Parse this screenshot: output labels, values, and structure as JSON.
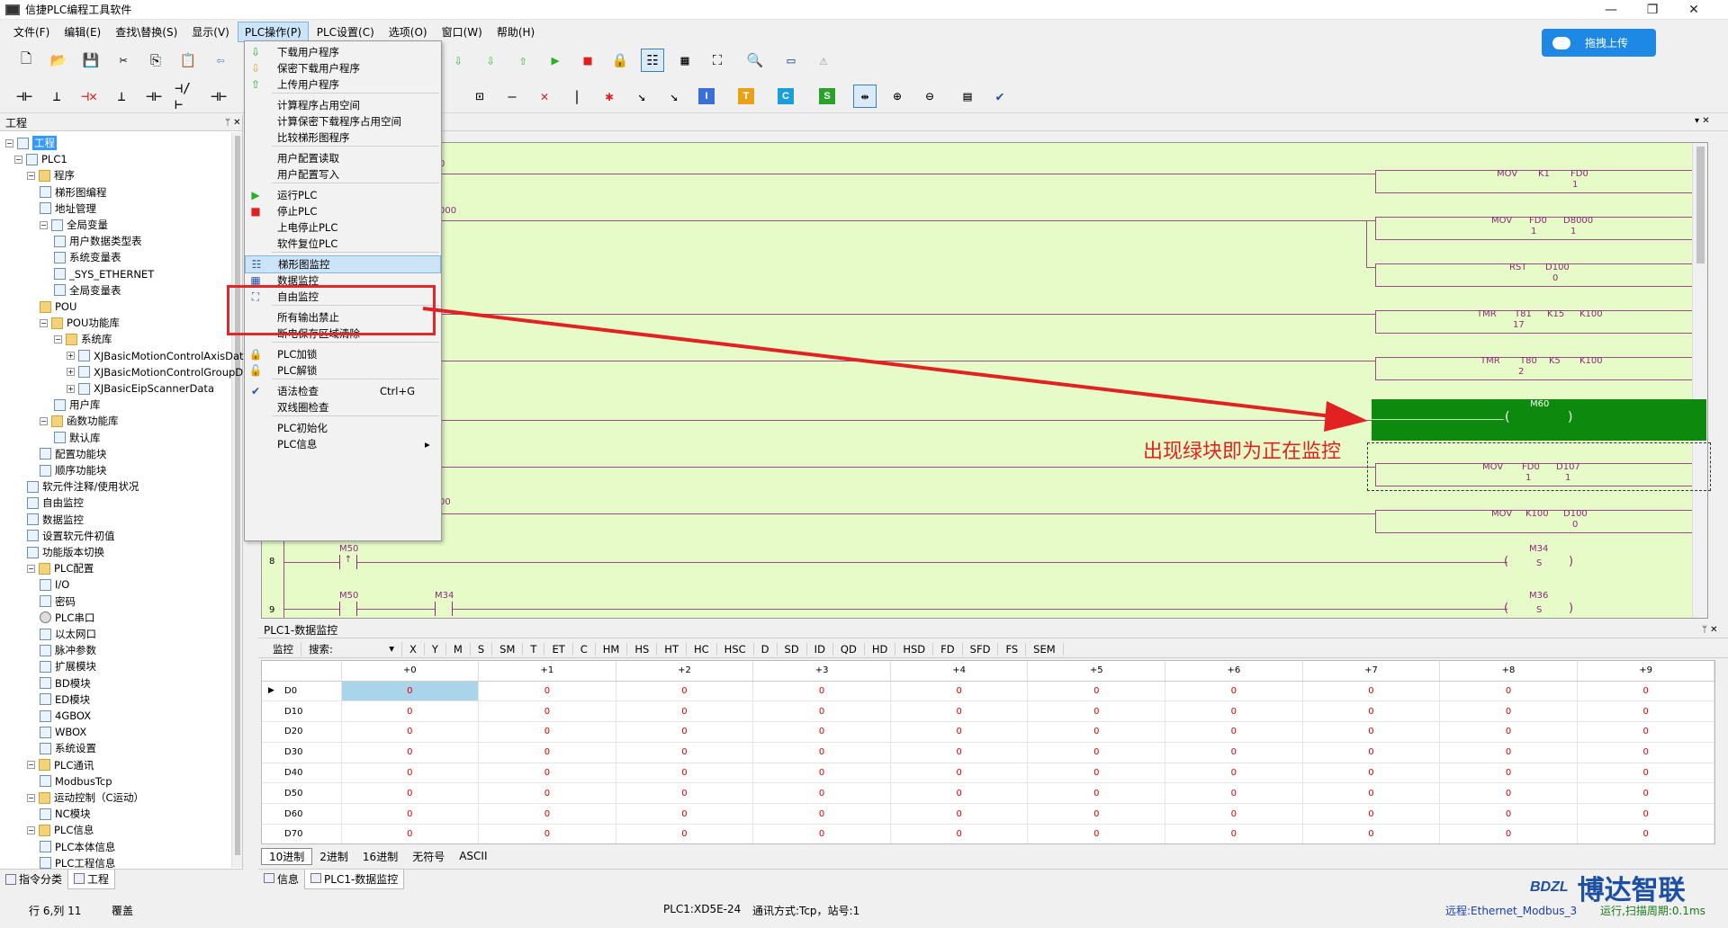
{
  "window": {
    "title": "信捷PLC编程工具软件",
    "min": "—",
    "max": "❐",
    "close": "✕"
  },
  "menubar": [
    "文件(F)",
    "编辑(E)",
    "查找\\替换(S)",
    "显示(V)",
    "PLC操作(P)",
    "PLC设置(C)",
    "选项(O)",
    "窗口(W)",
    "帮助(H)"
  ],
  "upload_button": "拖拽上传",
  "project_panel": {
    "title": "工程",
    "pin": "ᛘ  ✕",
    "tree": [
      "工程",
      "PLC1",
      "程序",
      "梯形图编程",
      "地址管理",
      "全局变量",
      "用户数据类型表",
      "系统变量表",
      "_SYS_ETHERNET",
      "全局变量表",
      "POU",
      "POU功能库",
      "系统库",
      "XJBasicMotionControlAxisDat",
      "XJBasicMotionControlGroupD",
      "XJBasicEipScannerData",
      "用户库",
      "函数功能库",
      "默认库",
      "配置功能块",
      "顺序功能块",
      "软元件注释/使用状况",
      "自由监控",
      "数据监控",
      "设置软元件初值",
      "功能版本切换",
      "PLC配置",
      "I/O",
      "密码",
      "PLC串口",
      "以太网口",
      "脉冲参数",
      "扩展模块",
      "BD模块",
      "ED模块",
      "4GBOX",
      "WBOX",
      "系统设置",
      "PLC通讯",
      "ModbusTcp",
      "运动控制（C运动）",
      "NC模块",
      "PLC信息",
      "PLC本体信息",
      "PLC工程信息"
    ],
    "bottom_tabs": [
      "指令分类",
      "工程"
    ]
  },
  "plc_menu": {
    "items": [
      "下载用户程序",
      "保密下载用户程序",
      "上传用户程序",
      "计算程序占用空间",
      "计算保密下载程序占用空间",
      "比较梯形图程序",
      "用户配置读取",
      "用户配置写入",
      "运行PLC",
      "停止PLC",
      "上电停止PLC",
      "软件复位PLC",
      "梯形图监控",
      "数据监控",
      "自由监控",
      "所有输出禁止",
      "断电保存区域清除",
      "PLC加锁",
      "PLC解锁",
      "语法检查",
      "双线圈检查",
      "PLC初始化",
      "PLC信息"
    ],
    "shortcut_syntax": "Ctrl+G",
    "submenu_arrow": "▸"
  },
  "ladder": {
    "blocks": [
      {
        "op": "MOV",
        "a": "K1",
        "b": "FD0",
        "va": "",
        "vb": "1"
      },
      {
        "op": "MOV",
        "a": "FD0",
        "b": "D8000",
        "va": "1",
        "vb": "1"
      },
      {
        "op": "RST",
        "a": "D100",
        "b": "",
        "va": "0",
        "vb": ""
      },
      {
        "op": "TMR",
        "a": "T81",
        "b": "K15",
        "c": "K100",
        "va": "17"
      },
      {
        "op": "TMR",
        "a": "T80",
        "b": "K5",
        "c": "K100",
        "va": "2"
      },
      {
        "op": "MOV",
        "a": "FD0",
        "b": "D107",
        "va": "1",
        "vb": "1"
      },
      {
        "op": "MOV",
        "a": "K100",
        "b": "D100",
        "va": "",
        "vb": "0"
      }
    ],
    "partial_labels": [
      "0",
      "000",
      "00"
    ],
    "coil_green": "M60",
    "coil_paren_l": "(",
    "coil_paren_r": ")",
    "annotation": "出现绿块即为正在监控",
    "row8": {
      "num": "8",
      "contact": "M50",
      "coil": "M34",
      "coil_op": "S"
    },
    "row9": {
      "num": "9",
      "contact1": "M50",
      "contact2": "M34",
      "coil": "M36",
      "coil_op": "S"
    }
  },
  "data_monitor": {
    "title": "PLC1-数据监控",
    "pin": "ᛘ  ✕",
    "bar_monitor": "监控",
    "bar_search": "搜索:",
    "bar_dropdown": "▾",
    "types": [
      "X",
      "Y",
      "M",
      "S",
      "SM",
      "T",
      "ET",
      "C",
      "HM",
      "HS",
      "HT",
      "HC",
      "HSC",
      "D",
      "SD",
      "ID",
      "QD",
      "HD",
      "HSD",
      "FD",
      "SFD",
      "FS",
      "SEM"
    ],
    "columns": [
      "+0",
      "+1",
      "+2",
      "+3",
      "+4",
      "+5",
      "+6",
      "+7",
      "+8",
      "+9"
    ],
    "rows": [
      {
        "addr": "D0",
        "vals": [
          "0",
          "0",
          "0",
          "0",
          "0",
          "0",
          "0",
          "0",
          "0",
          "0"
        ]
      },
      {
        "addr": "D10",
        "vals": [
          "0",
          "0",
          "0",
          "0",
          "0",
          "0",
          "0",
          "0",
          "0",
          "0"
        ]
      },
      {
        "addr": "D20",
        "vals": [
          "0",
          "0",
          "0",
          "0",
          "0",
          "0",
          "0",
          "0",
          "0",
          "0"
        ]
      },
      {
        "addr": "D30",
        "vals": [
          "0",
          "0",
          "0",
          "0",
          "0",
          "0",
          "0",
          "0",
          "0",
          "0"
        ]
      },
      {
        "addr": "D40",
        "vals": [
          "0",
          "0",
          "0",
          "0",
          "0",
          "0",
          "0",
          "0",
          "0",
          "0"
        ]
      },
      {
        "addr": "D50",
        "vals": [
          "0",
          "0",
          "0",
          "0",
          "0",
          "0",
          "0",
          "0",
          "0",
          "0"
        ]
      },
      {
        "addr": "D60",
        "vals": [
          "0",
          "0",
          "0",
          "0",
          "0",
          "0",
          "0",
          "0",
          "0",
          "0"
        ]
      },
      {
        "addr": "D70",
        "vals": [
          "0",
          "0",
          "0",
          "0",
          "0",
          "0",
          "0",
          "0",
          "0",
          "0"
        ]
      }
    ],
    "row_marker": "▶",
    "format_tabs": [
      "10进制",
      "2进制",
      "16进制",
      "无符号",
      "ASCII"
    ]
  },
  "bottom_tabs": [
    "信息",
    "PLC1-数据监控"
  ],
  "status": {
    "position": "行 6,列 11",
    "mode": "覆盖",
    "plc": "PLC1:XD5E-24",
    "comm": "通讯方式:Tcp，站号:1",
    "remote": "远程:Ethernet_Modbus_3",
    "run": "运行,扫描周期:0.1ms"
  },
  "logo": {
    "badge": "BDZL",
    "brand": "博达智联"
  },
  "colors": {
    "ladder_bg": "#e6fbc8",
    "monitor_green": "#0d8a0d",
    "annotation_red": "#e22222",
    "wire": "#9a4b8c",
    "accent_blue": "#1e88e5"
  }
}
